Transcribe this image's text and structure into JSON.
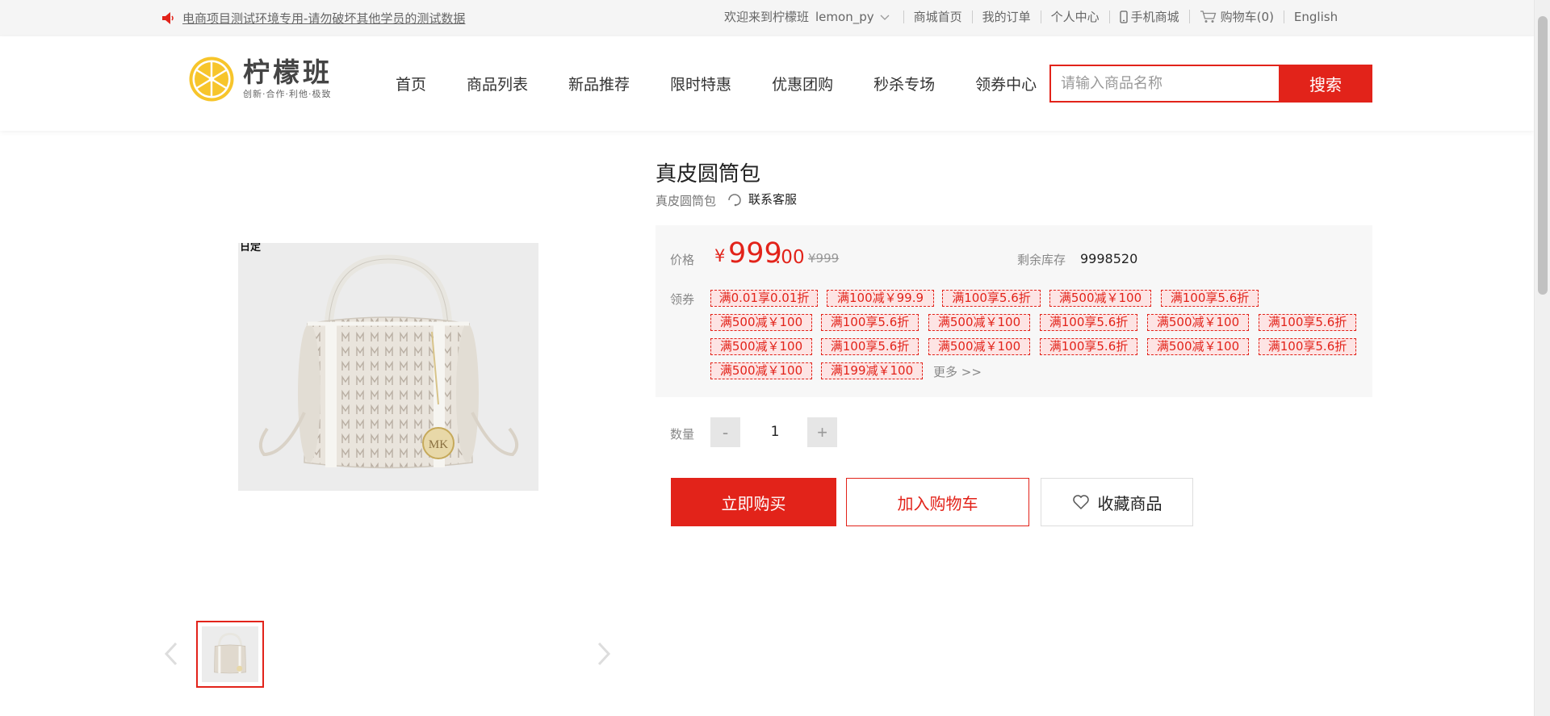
{
  "topbar": {
    "notice": "电商项目测试环境专用-请勿破坏其他学员的测试数据",
    "welcome": "欢迎来到柠檬班",
    "username": "lemon_py",
    "links": [
      "商城首页",
      "我的订单",
      "个人中心"
    ],
    "mobile": "手机商城",
    "cart": "购物车(0)",
    "language": "English"
  },
  "header": {
    "logo_name": "柠檬班",
    "logo_slogan": "创新·合作·利他·极致",
    "nav": [
      "首页",
      "商品列表",
      "新品推荐",
      "限时特惠",
      "优惠团购",
      "秒杀专场",
      "领券中心"
    ],
    "search_placeholder": "请输入商品名称",
    "search_button": "搜索"
  },
  "product": {
    "title": "真皮圆筒包",
    "subtitle": "真皮圆筒包",
    "service": "联系客服",
    "price_label": "价格",
    "currency": "¥",
    "price_int": "999",
    "price_dec": ".00",
    "price_old": "¥999",
    "stock_label": "剩余库存",
    "stock": "9998520",
    "coupon_label": "领券",
    "coupons": [
      [
        "满0.01享0.01折",
        "满100减￥99.9",
        "满100享5.6折",
        "满500减￥100",
        "满100享5.6折"
      ],
      [
        "满500减￥100",
        "满100享5.6折",
        "满500减￥100",
        "满100享5.6折",
        "满500减￥100",
        "满100享5.6折"
      ],
      [
        "满500减￥100",
        "满100享5.6折",
        "满500减￥100",
        "满100享5.6折",
        "满500减￥100",
        "满100享5.6折"
      ],
      [
        "满500减￥100",
        "满199减￥100"
      ]
    ],
    "more": "更多 >>",
    "qty_label": "数量",
    "qty_minus": "-",
    "qty_value": "1",
    "qty_plus": "+",
    "buy": "立即购买",
    "add_cart": "加入购物车",
    "favorite": "收藏商品"
  },
  "image": {
    "corner_text": "日定"
  },
  "colors": {
    "accent": "#e2231a",
    "logo_yellow": "#f7c52b",
    "price_box_bg": "#f7f7f7"
  },
  "icons": [
    "speaker-icon",
    "chevron-down-icon",
    "phone-icon",
    "cart-icon",
    "headset-icon",
    "heart-icon",
    "chevron-left-icon",
    "chevron-right-icon"
  ]
}
